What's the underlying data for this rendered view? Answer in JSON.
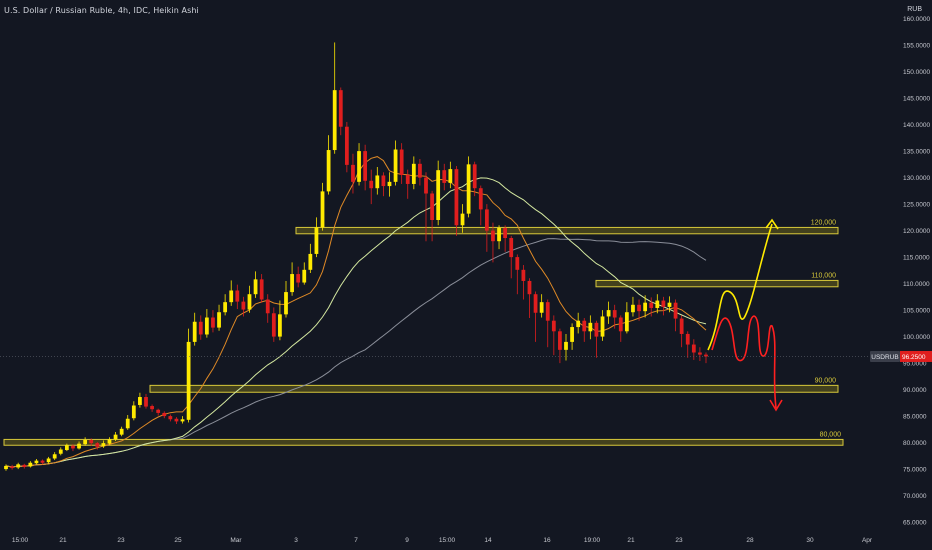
{
  "header": {
    "title": "U.S. Dollar / Russian Ruble, 4h, IDC, Heikin Ashi",
    "currency": "RUB"
  },
  "colors": {
    "background": "#131722",
    "up_candle": "#ffea00",
    "down_candle": "#e01e1e",
    "zone_fill": "#6b6419",
    "zone_border": "#d8c93a",
    "zone_label": "#d8c93a",
    "ma_fast": "#e08a26",
    "ma_mid": "#d4e8a0",
    "ma_slow": "#8a8e99",
    "axis_text": "#c6c8cf",
    "price_tag": "#e01e1e",
    "symbol_tag": "#3a3e4a",
    "drawing_yellow": "#ffea00",
    "drawing_red": "#ff2020"
  },
  "chart_data": {
    "type": "candlestick",
    "title": "U.S. Dollar / Russian Ruble, 4h, IDC, Heikin Ashi",
    "y_unit": "RUB",
    "ylim": [
      62,
      162
    ],
    "y_ticks": [
      "160.0000",
      "155.0000",
      "150.0000",
      "145.0000",
      "140.0000",
      "135.0000",
      "130.0000",
      "125.0000",
      "120.0000",
      "115.0000",
      "110.0000",
      "105.0000",
      "100.0000",
      "95.0000",
      "90.0000",
      "85.0000",
      "80.0000",
      "75.0000",
      "70.0000",
      "65.0000"
    ],
    "x_ticks": [
      "15:00",
      "21",
      "23",
      "25",
      "Mar",
      "3",
      "7",
      "9",
      "15:00",
      "14",
      "16",
      "19:00",
      "21",
      "23",
      "28",
      "30",
      "Apr"
    ],
    "current_price": {
      "value": 96.25,
      "label": "96.2500",
      "symbol": "USDRUB"
    },
    "zones": [
      {
        "label": "120,000",
        "low": 119.4,
        "high": 120.6
      },
      {
        "label": "110,000",
        "low": 109.4,
        "high": 110.6
      },
      {
        "label": "90,000",
        "low": 89.5,
        "high": 90.8
      },
      {
        "label": "80,000",
        "low": 79.5,
        "high": 80.6
      }
    ],
    "candles": [
      [
        75.0,
        75.6,
        74.7,
        75.9
      ],
      [
        75.5,
        75.2,
        74.9,
        75.8
      ],
      [
        75.3,
        75.9,
        75.0,
        76.2
      ],
      [
        75.8,
        75.4,
        75.1,
        76.0
      ],
      [
        75.5,
        76.2,
        75.3,
        76.5
      ],
      [
        76.1,
        76.6,
        75.9,
        76.9
      ],
      [
        76.6,
        76.2,
        75.9,
        76.8
      ],
      [
        76.3,
        77.0,
        76.0,
        77.3
      ],
      [
        77.0,
        77.8,
        76.7,
        78.2
      ],
      [
        77.9,
        78.7,
        77.6,
        79.1
      ],
      [
        78.6,
        79.5,
        78.4,
        79.8
      ],
      [
        79.4,
        78.9,
        78.4,
        79.7
      ],
      [
        78.9,
        79.8,
        78.7,
        80.2
      ],
      [
        79.7,
        80.5,
        79.4,
        81.0
      ],
      [
        80.5,
        79.9,
        79.4,
        80.8
      ],
      [
        79.9,
        79.2,
        78.7,
        80.1
      ],
      [
        79.3,
        79.9,
        79.0,
        80.4
      ],
      [
        79.8,
        80.6,
        79.6,
        81.0
      ],
      [
        80.6,
        81.5,
        80.3,
        82.0
      ],
      [
        81.5,
        82.6,
        81.2,
        83.0
      ],
      [
        82.7,
        84.5,
        82.4,
        85.2
      ],
      [
        84.6,
        87.0,
        84.2,
        87.8
      ],
      [
        87.1,
        88.6,
        86.6,
        89.4
      ],
      [
        88.6,
        86.8,
        86.4,
        89.2
      ],
      [
        86.9,
        86.3,
        85.8,
        87.2
      ],
      [
        86.2,
        85.6,
        85.1,
        86.4
      ],
      [
        85.6,
        85.0,
        84.6,
        85.9
      ],
      [
        85.0,
        84.4,
        84.0,
        85.3
      ],
      [
        84.5,
        84.0,
        83.5,
        84.8
      ],
      [
        84.0,
        84.4,
        83.6,
        85.0
      ],
      [
        84.3,
        99.0,
        83.8,
        101.5
      ],
      [
        99.0,
        102.8,
        98.3,
        104.5
      ],
      [
        102.8,
        100.4,
        99.4,
        104.0
      ],
      [
        100.4,
        103.6,
        99.8,
        105.2
      ],
      [
        103.6,
        101.7,
        100.8,
        105.0
      ],
      [
        101.7,
        104.6,
        101.1,
        106.0
      ],
      [
        104.6,
        106.5,
        104.0,
        108.0
      ],
      [
        106.5,
        108.7,
        105.8,
        110.6
      ],
      [
        108.7,
        106.6,
        105.2,
        109.8
      ],
      [
        106.6,
        105.1,
        103.8,
        107.5
      ],
      [
        105.1,
        108.0,
        104.5,
        109.6
      ],
      [
        108.0,
        110.8,
        107.3,
        112.3
      ],
      [
        110.8,
        107.0,
        106.4,
        111.8
      ],
      [
        107.0,
        104.4,
        102.6,
        108.0
      ],
      [
        104.4,
        100.0,
        99.0,
        105.5
      ],
      [
        100.0,
        104.2,
        99.3,
        106.8
      ],
      [
        104.2,
        108.4,
        103.6,
        110.5
      ],
      [
        108.4,
        111.8,
        107.7,
        114.0
      ],
      [
        111.8,
        110.2,
        109.3,
        113.2
      ],
      [
        110.2,
        112.6,
        109.8,
        114.0
      ],
      [
        112.6,
        115.6,
        112.0,
        117.5
      ],
      [
        115.6,
        120.6,
        115.0,
        122.5
      ],
      [
        120.6,
        127.4,
        120.0,
        129.0
      ],
      [
        127.4,
        135.2,
        126.8,
        138.0
      ],
      [
        135.2,
        146.5,
        134.5,
        155.5
      ],
      [
        146.5,
        139.6,
        138.0,
        147.0
      ],
      [
        139.6,
        132.4,
        131.0,
        140.5
      ],
      [
        132.4,
        129.2,
        127.0,
        134.5
      ],
      [
        129.2,
        135.0,
        128.5,
        136.5
      ],
      [
        135.0,
        129.4,
        127.6,
        136.2
      ],
      [
        129.4,
        128.0,
        125.0,
        131.5
      ],
      [
        128.0,
        130.4,
        126.8,
        132.0
      ],
      [
        130.4,
        128.4,
        126.5,
        131.0
      ],
      [
        128.4,
        129.2,
        126.4,
        131.0
      ],
      [
        129.2,
        135.3,
        128.5,
        137.0
      ],
      [
        135.3,
        130.5,
        128.8,
        136.5
      ],
      [
        130.5,
        128.8,
        126.0,
        131.5
      ],
      [
        128.8,
        132.6,
        127.8,
        134.0
      ],
      [
        132.6,
        130.0,
        128.5,
        133.5
      ],
      [
        130.0,
        127.0,
        118.0,
        131.0
      ],
      [
        127.0,
        122.0,
        118.0,
        127.5
      ],
      [
        122.0,
        131.4,
        121.0,
        133.2
      ],
      [
        131.4,
        129.0,
        127.6,
        132.6
      ],
      [
        129.0,
        131.6,
        128.0,
        133.0
      ],
      [
        131.6,
        121.0,
        119.0,
        132.2
      ],
      [
        121.0,
        123.2,
        119.6,
        125.0
      ],
      [
        123.2,
        132.5,
        122.5,
        134.0
      ],
      [
        132.5,
        128.0,
        126.5,
        133.0
      ],
      [
        128.0,
        124.0,
        121.0,
        128.5
      ],
      [
        124.0,
        120.0,
        116.0,
        125.0
      ],
      [
        120.0,
        118.0,
        114.0,
        121.5
      ],
      [
        118.0,
        120.5,
        116.5,
        121.0
      ],
      [
        120.5,
        118.6,
        116.0,
        121.0
      ],
      [
        118.6,
        115.0,
        111.0,
        119.0
      ],
      [
        115.0,
        112.6,
        108.0,
        115.5
      ],
      [
        112.6,
        110.5,
        107.0,
        113.5
      ],
      [
        110.5,
        108.0,
        103.5,
        111.0
      ],
      [
        108.0,
        104.5,
        99.0,
        108.5
      ],
      [
        104.5,
        106.5,
        103.6,
        108.0
      ],
      [
        106.5,
        103.0,
        98.0,
        107.0
      ],
      [
        103.0,
        101.0,
        96.5,
        104.0
      ],
      [
        101.0,
        97.5,
        95.0,
        101.5
      ],
      [
        97.5,
        99.0,
        95.5,
        100.5
      ],
      [
        99.0,
        101.8,
        97.5,
        102.5
      ],
      [
        101.8,
        103.0,
        100.6,
        104.5
      ],
      [
        103.0,
        101.0,
        99.0,
        103.5
      ],
      [
        101.0,
        102.6,
        99.5,
        104.0
      ],
      [
        102.6,
        100.0,
        96.0,
        103.0
      ],
      [
        100.0,
        103.8,
        99.2,
        105.0
      ],
      [
        103.8,
        105.0,
        102.4,
        106.6
      ],
      [
        105.0,
        103.6,
        101.5,
        106.0
      ],
      [
        103.6,
        101.0,
        99.0,
        104.0
      ],
      [
        101.0,
        104.6,
        100.6,
        106.5
      ],
      [
        104.6,
        106.0,
        103.8,
        107.5
      ],
      [
        106.0,
        104.8,
        103.0,
        107.0
      ],
      [
        104.8,
        106.4,
        103.6,
        107.8
      ],
      [
        106.4,
        105.4,
        103.8,
        107.4
      ],
      [
        105.4,
        106.8,
        104.4,
        108.0
      ],
      [
        106.8,
        105.6,
        104.0,
        107.5
      ],
      [
        105.6,
        106.4,
        104.6,
        107.6
      ],
      [
        106.4,
        103.4,
        101.0,
        107.0
      ],
      [
        103.4,
        100.5,
        98.0,
        104.0
      ],
      [
        100.5,
        98.5,
        96.0,
        101.0
      ],
      [
        98.5,
        97.0,
        95.6,
        99.5
      ],
      [
        97.0,
        96.6,
        95.4,
        98.0
      ],
      [
        96.6,
        96.25,
        95.0,
        97.0
      ]
    ]
  }
}
